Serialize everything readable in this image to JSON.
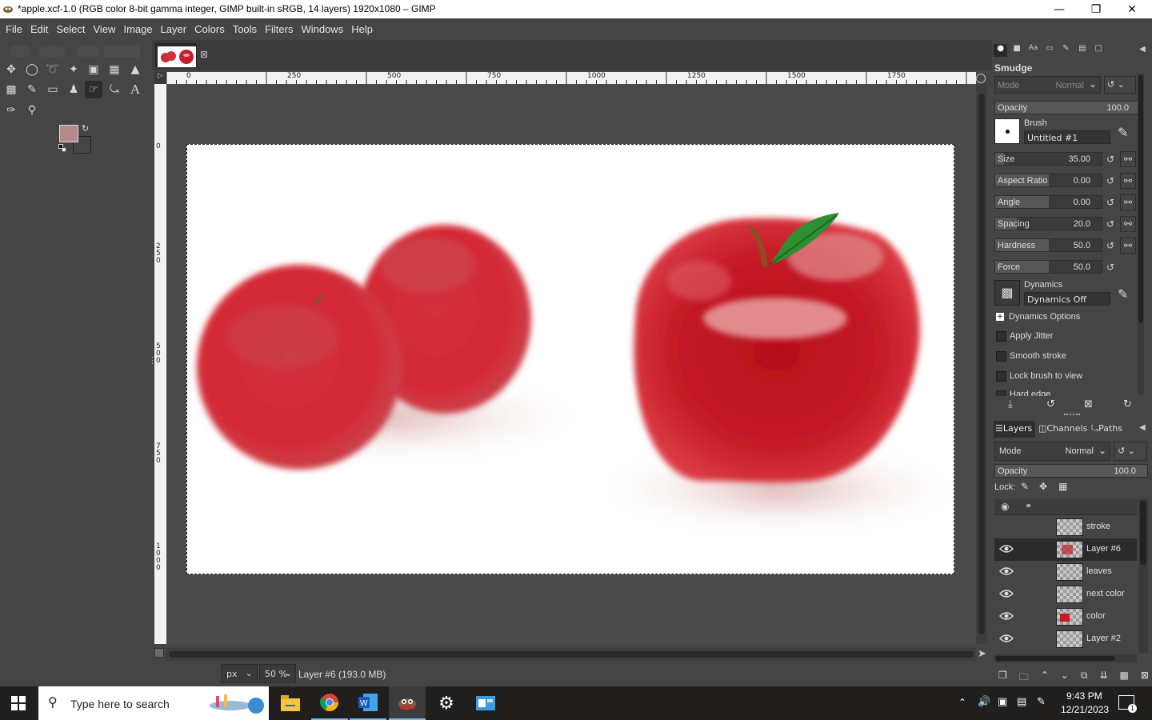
{
  "window": {
    "title": "*apple.xcf-1.0 (RGB color 8-bit gamma integer, GIMP built-in sRGB, 14 layers) 1920x1080 – GIMP"
  },
  "menu": [
    "File",
    "Edit",
    "Select",
    "View",
    "Image",
    "Layer",
    "Colors",
    "Tools",
    "Filters",
    "Windows",
    "Help"
  ],
  "rulers": {
    "top": [
      "0",
      "250",
      "500",
      "750",
      "1000",
      "1250",
      "1500",
      "1750"
    ],
    "left": [
      "0",
      "250",
      "500",
      "750",
      "1000"
    ]
  },
  "statusbar": {
    "unit": "px",
    "zoom": "50 %",
    "layer_info": "Layer #6 (193.0 MB)"
  },
  "tool_options": {
    "tool_name": "Smudge",
    "mode_label": "Mode",
    "mode_value": "Normal",
    "opacity_label": "Opacity",
    "opacity_value": "100.0",
    "brush_label": "Brush",
    "brush_value": "Untitled #1",
    "sliders": [
      {
        "label": "Size",
        "value": "35.00",
        "fill": 0.08
      },
      {
        "label": "Aspect Ratio",
        "value": "0.00",
        "fill": 0.5
      },
      {
        "label": "Angle",
        "value": "0.00",
        "fill": 0.5
      },
      {
        "label": "Spacing",
        "value": "20.0",
        "fill": 0.2
      },
      {
        "label": "Hardness",
        "value": "50.0",
        "fill": 0.5
      },
      {
        "label": "Force",
        "value": "50.0",
        "fill": 0.5
      }
    ],
    "dynamics_label": "Dynamics",
    "dynamics_value": "Dynamics Off",
    "dynamics_options": "Dynamics Options",
    "checkboxes": [
      "Apply Jitter",
      "Smooth stroke",
      "Lock brush to view",
      "Hard edge"
    ]
  },
  "layers_panel": {
    "tabs": [
      "Layers",
      "Channels",
      "Paths"
    ],
    "mode_label": "Mode",
    "mode_value": "Normal",
    "opacity_label": "Opacity",
    "opacity_value": "100.0",
    "lock_label": "Lock:",
    "layers": [
      {
        "name": "stroke",
        "visible": false,
        "selected": false
      },
      {
        "name": "Layer #6",
        "visible": true,
        "selected": true
      },
      {
        "name": "leaves",
        "visible": true,
        "selected": false
      },
      {
        "name": "next color",
        "visible": true,
        "selected": false
      },
      {
        "name": "color",
        "visible": true,
        "selected": false
      },
      {
        "name": "Layer #2",
        "visible": true,
        "selected": false
      }
    ]
  },
  "colors": {
    "foreground": "#b58a88",
    "background": "#ffffff",
    "ui_bg": "#454545"
  },
  "taskbar": {
    "search_placeholder": "Type here to search",
    "time": "9:43 PM",
    "date": "12/21/2023",
    "notification_count": "1"
  }
}
